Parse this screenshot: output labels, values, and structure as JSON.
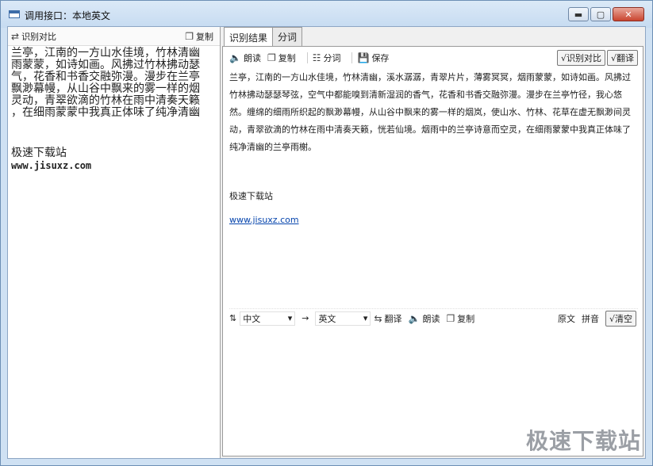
{
  "window": {
    "title": "调用接口：本地英文"
  },
  "left_toolbar": {
    "compare": "识别对比",
    "copy": "复制"
  },
  "left_text": {
    "lines": [
      "兰亭，江南的一方山水佳境，竹林清幽",
      "雨蒙蒙，如诗如画。风拂过竹林拂动瑟",
      "气，花香和书香交融弥漫。漫步在兰亭",
      "飘渺幕幔，从山谷中飘来的雾一样的烟",
      "灵动，青翠欲滴的竹林在雨中清奏天籁",
      "，在细雨蒙蒙中我真正体味了纯净清幽"
    ],
    "site": "极速下载站",
    "url": "www.jisuxz.com"
  },
  "tabs": [
    "识别结果",
    "分词"
  ],
  "result_toolbar": {
    "read": "朗读",
    "copy": "复制",
    "segment": "分词",
    "save": "保存",
    "compare": "√识别对比",
    "translate": "√翻译"
  },
  "result": {
    "paragraph": "兰亭，江南的一方山水佳境，竹林清幽，溪水潺潺，青翠片片，薄雾冥冥，烟雨蒙蒙，如诗如画。风拂过竹林拂动瑟瑟琴弦，空气中都能嗅到清新湿润的香气，花香和书香交融弥漫。漫步在兰亭竹径，我心悠然。缠绵的细雨所织起的飘渺幕幔，从山谷中飘来的雾一样的烟岚，使山水、竹林、花草在虚无飘渺间灵动，青翠欲滴的竹林在雨中清奏天籁，恍若仙境。烟雨中的兰亭诗意而空灵，在细雨蒙蒙中我真正体味了纯净清幽的兰亭雨榭。",
    "site": "极速下载站",
    "url": "www.jisuxz.com"
  },
  "translate_bar": {
    "from": "中文",
    "to": "英文",
    "translate": "翻译",
    "read": "朗读",
    "copy": "复制",
    "original": "原文",
    "pinyin": "拼音",
    "clear": "√清空"
  },
  "watermark": "极速下载站"
}
